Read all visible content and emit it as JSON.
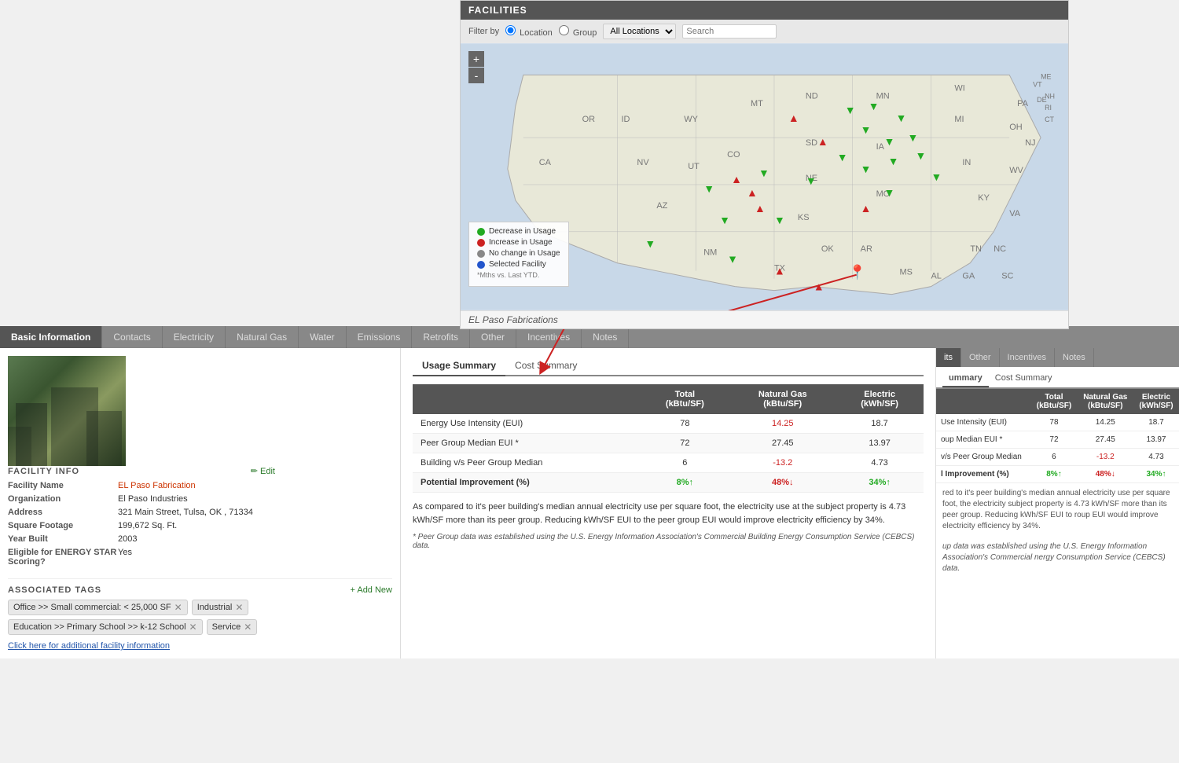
{
  "facilities": {
    "title": "FACILITIES",
    "filter_label": "Filter by",
    "filter_options": [
      "Location",
      "Group"
    ],
    "location_select": "All Locations",
    "search_placeholder": "Search"
  },
  "map": {
    "zoom_in": "+",
    "zoom_out": "-",
    "legend": [
      {
        "color": "green",
        "label": "Decrease in Usage"
      },
      {
        "color": "red",
        "label": "Increase in Usage"
      },
      {
        "color": "gray",
        "label": "No change in Usage"
      },
      {
        "color": "blue",
        "label": "Selected Facility"
      }
    ],
    "legend_footnote": "*Mths vs. Last YTD.",
    "facility_label": "EL Paso Fabrications"
  },
  "tabs": [
    {
      "id": "basic",
      "label": "Basic Information",
      "active": true
    },
    {
      "id": "contacts",
      "label": "Contacts"
    },
    {
      "id": "electricity",
      "label": "Electricity"
    },
    {
      "id": "natural_gas",
      "label": "Natural Gas"
    },
    {
      "id": "water",
      "label": "Water"
    },
    {
      "id": "emissions",
      "label": "Emissions"
    },
    {
      "id": "retrofits",
      "label": "Retrofits"
    },
    {
      "id": "other",
      "label": "Other"
    },
    {
      "id": "incentives",
      "label": "Incentives"
    },
    {
      "id": "notes",
      "label": "Notes"
    }
  ],
  "facility_info": {
    "section_title": "FACILITY INFO",
    "edit_label": "✏ Edit",
    "fields": [
      {
        "label": "Facility Name",
        "value": "EL Paso Fabrication",
        "is_link": true
      },
      {
        "label": "Organization",
        "value": "El Paso Industries",
        "is_link": false
      },
      {
        "label": "Address",
        "value": "321 Main Street, Tulsa, OK , 71334",
        "is_link": false
      },
      {
        "label": "Square Footage",
        "value": "199,672 Sq. Ft.",
        "is_link": false
      },
      {
        "label": "Year Built",
        "value": "2003",
        "is_link": false
      },
      {
        "label": "Eligible for ENERGY STAR Scoring?",
        "value": "Yes",
        "is_link": false
      }
    ]
  },
  "tags": {
    "section_title": "ASSOCIATED TAGS",
    "add_label": "+ Add New",
    "items": [
      "Office >> Small commercial: < 25,000 SF",
      "Industrial",
      "Education >> Primary School >> k-12 School",
      "Service"
    ],
    "more_info_link": "Click here for additional facility information"
  },
  "usage_summary": {
    "sub_tabs": [
      {
        "label": "Usage Summary",
        "active": true
      },
      {
        "label": "Cost Summary",
        "active": false
      }
    ],
    "table": {
      "headers": [
        "",
        "Total\n(kBtu/SF)",
        "Natural Gas\n(kBtu/SF)",
        "Electric\n(kWh/SF)"
      ],
      "rows": [
        {
          "label": "Energy Use Intensity (EUI)",
          "total": "78",
          "nat_gas": "14.25",
          "electric": "18.7",
          "nat_gas_colored": false,
          "electric_colored": false
        },
        {
          "label": "Peer Group Median EUI *",
          "total": "72",
          "nat_gas": "27.45",
          "electric": "13.97",
          "nat_gas_colored": true,
          "electric_colored": false
        },
        {
          "label": "Building v/s Peer Group Median",
          "total": "6",
          "nat_gas": "-13.2",
          "electric": "4.73",
          "nat_gas_colored": true,
          "electric_colored": false
        },
        {
          "label": "Potential Improvement (%)",
          "total": "8%↑",
          "nat_gas": "48%↓",
          "electric": "34%↑",
          "is_improvement": true
        }
      ]
    },
    "summary_text": "As compared to it's peer building's median annual electricity use per square foot, the electricity use at the subject property is 4.73 kWh/SF more than its peer group. Reducing kWh/SF EUI to the peer group EUI would improve electricity efficiency by 34%.",
    "footnote": "* Peer Group data was established using the U.S. Energy Information Association's Commercial Building Energy Consumption Service (CEBCS) data."
  },
  "far_right": {
    "tabs": [
      "its",
      "Other",
      "Incentives",
      "Notes"
    ],
    "active_tab": "its",
    "sub_tabs": [
      "ummary",
      "Cost Summary"
    ],
    "active_sub_tab": "ummary",
    "table": {
      "headers": [
        "",
        "Total\n(kBtu/SF)",
        "Natural Gas\n(kBtu/SF)",
        "Electric\n(kWh/SF)"
      ],
      "rows": [
        {
          "label": "Use Intensity (EUI)",
          "total": "78",
          "nat_gas": "14.25",
          "electric": "18.7"
        },
        {
          "label": "oup Median EUI *",
          "total": "72",
          "nat_gas": "27.45",
          "electric": "13.97"
        },
        {
          "label": "v/s Peer Group Median",
          "total": "6",
          "nat_gas": "-13.2",
          "electric": "4.73"
        },
        {
          "label": "l Improvement (%)",
          "total": "8%↑",
          "nat_gas": "48%↓",
          "electric": "34%↑",
          "is_improvement": true
        }
      ]
    },
    "note": "red to it's peer building's median annual electricity use per square foot, the electricity subject property is 4.73 kWh/SF more than its peer group. Reducing kWh/SF EUI to roup EUI would improve electricity efficiency by 34%.",
    "footnote": "up data was established using the U.S. Energy Information Association's Commercial nergy Consumption Service (CEBCS) data."
  }
}
